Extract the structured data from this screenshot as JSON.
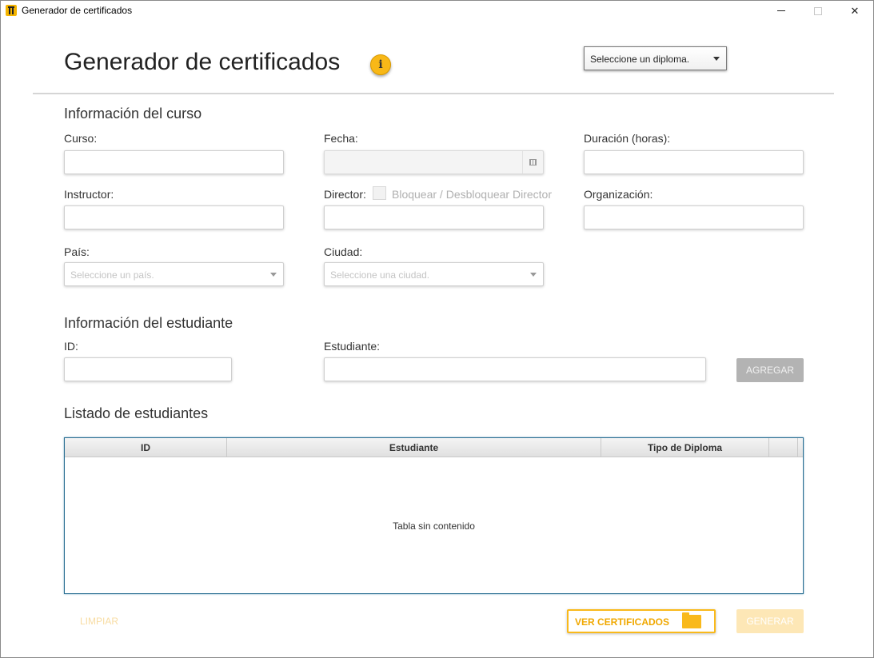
{
  "window": {
    "title": "Generador de certificados"
  },
  "header": {
    "title": "Generador de certificados",
    "info_symbol": "i",
    "diploma_select": {
      "value": "Seleccione un diploma."
    }
  },
  "course": {
    "section_title": "Información del curso",
    "curso_label": "Curso:",
    "curso_value": "",
    "fecha_label": "Fecha:",
    "fecha_value": "",
    "duracion_label": "Duración (horas):",
    "duracion_value": "",
    "instructor_label": "Instructor:",
    "instructor_value": "",
    "director_label": "Director:",
    "director_value": "",
    "director_lock_label": "Bloquear / Desbloquear Director",
    "organizacion_label": "Organización:",
    "organizacion_value": "",
    "pais_label": "País:",
    "pais_placeholder": "Seleccione un país.",
    "ciudad_label": "Ciudad:",
    "ciudad_placeholder": "Seleccione una ciudad."
  },
  "student": {
    "section_title": "Información del estudiante",
    "id_label": "ID:",
    "id_value": "",
    "estudiante_label": "Estudiante:",
    "estudiante_value": "",
    "agregar_label": "AGREGAR"
  },
  "list": {
    "section_title": "Listado de estudiantes",
    "columns": [
      "ID",
      "Estudiante",
      "Tipo de Diploma"
    ],
    "empty_message": "Tabla sin contenido",
    "rows": []
  },
  "footer": {
    "limpiar_label": "LIMPIAR",
    "ver_certificados_label": "VER CERTIFICADOS",
    "generar_label": "GENERAR"
  },
  "colors": {
    "accent": "#f9b91b",
    "table_border": "#2a6f93"
  },
  "icons": {
    "app": "app-logo-icon",
    "info": "info-icon",
    "calendar": "calendar-icon",
    "folder": "folder-icon"
  }
}
